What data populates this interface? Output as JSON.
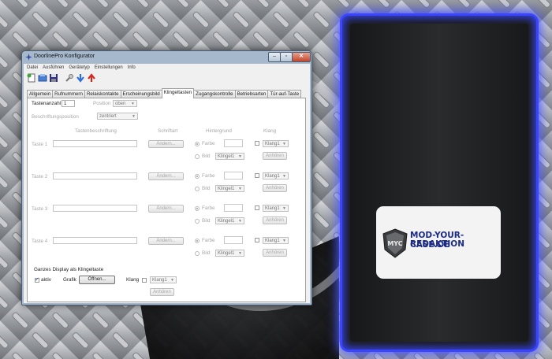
{
  "window": {
    "title": "DoorlinePro Konfigurator",
    "controls": [
      "–",
      "▫",
      "✕"
    ]
  },
  "menu": [
    "Datei",
    "Ausführen",
    "Gerätetyp",
    "Einstellungen",
    "Info"
  ],
  "tabs": [
    "Allgemein",
    "Rufnummern",
    "Relaiskontakte",
    "Erscheinungsbild",
    "Klingeltasten",
    "Zugangskontrolle",
    "Betriebsarten",
    "Tür-auf-Taste"
  ],
  "active_tab": "Klingeltasten",
  "top": {
    "tastenanzahl_label": "Tastenanzahl",
    "tastenanzahl_value": "1",
    "position_label": "Position",
    "position_value": "oben",
    "beschriftung_label": "Beschriftungsposition",
    "beschriftung_value": "zentriert"
  },
  "headers": {
    "tastenbeschriftung": "Tastenbeschriftung",
    "schriftart": "Schriftart",
    "hintergrund": "Hintergrund",
    "klang": "Klang"
  },
  "rows": [
    {
      "label": "Taste 1",
      "aendern": "Ändern...",
      "farbe": "Farbe",
      "bild": "Bild",
      "bild_value": "Klingel1",
      "klang": "Klang1",
      "anhoeren": "Anhören"
    },
    {
      "label": "Taste 2",
      "aendern": "Ändern...",
      "farbe": "Farbe",
      "bild": "Bild",
      "bild_value": "Klingel1",
      "klang": "Klang1",
      "anhoeren": "Anhören"
    },
    {
      "label": "Taste 3",
      "aendern": "Ändern...",
      "farbe": "Farbe",
      "bild": "Bild",
      "bild_value": "Klingel1",
      "klang": "Klang1",
      "anhoeren": "Anhören"
    },
    {
      "label": "Taste 4",
      "aendern": "Ändern...",
      "farbe": "Farbe",
      "bild": "Bild",
      "bild_value": "Klingel1",
      "klang": "Klang1",
      "anhoeren": "Anhören"
    }
  ],
  "bottom": {
    "title": "Ganzes Display als Klingeltaste",
    "aktiv": "aktiv",
    "grafik": "Grafik",
    "oeffnen": "Öffnen...",
    "klang_label": "Klang",
    "klang_value": "Klang1",
    "anhoeren": "Anhören"
  },
  "preview": {
    "line1": "MOD-YOUR-CASE.DE",
    "line2": "REDAKTION",
    "logo_text": "MYC",
    "accent_color": "#3b45ff"
  }
}
